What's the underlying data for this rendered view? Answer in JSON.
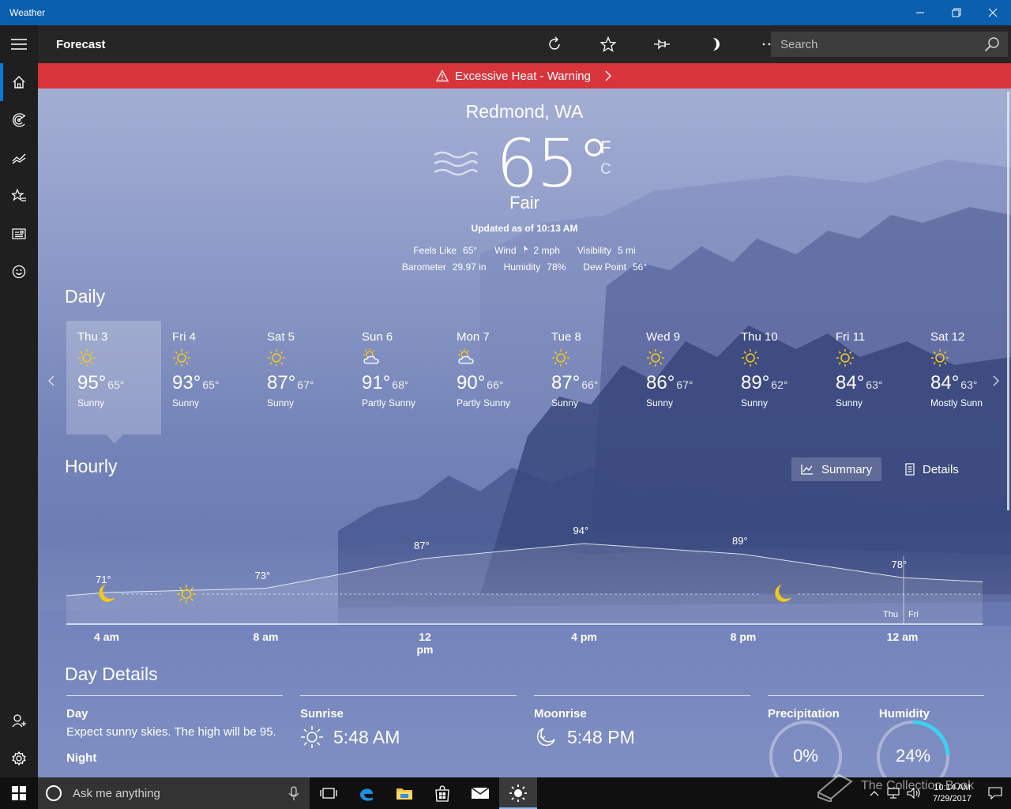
{
  "window": {
    "title": "Weather"
  },
  "command_bar": {
    "page_title": "Forecast",
    "search_placeholder": "Search"
  },
  "alert": {
    "text": "Excessive Heat - Warning"
  },
  "current": {
    "location": "Redmond, WA",
    "temperature": "65°",
    "unit_f": "F",
    "unit_c": "C",
    "condition": "Fair",
    "updated": "Updated as of 10:13 AM",
    "feels_like_label": "Feels Like",
    "feels_like": "65°",
    "wind_label": "Wind",
    "wind": "2 mph",
    "visibility_label": "Visibility",
    "visibility": "5 mi",
    "barometer_label": "Barometer",
    "barometer": "29.97 in",
    "humidity_label": "Humidity",
    "humidity": "78%",
    "dew_point_label": "Dew Point",
    "dew_point": "56°"
  },
  "daily": {
    "heading": "Daily",
    "days": [
      {
        "name": "Thu 3",
        "hi": "95°",
        "lo": "65°",
        "cond": "Sunny",
        "icon": "sun-icon"
      },
      {
        "name": "Fri 4",
        "hi": "93°",
        "lo": "65°",
        "cond": "Sunny",
        "icon": "sun-icon"
      },
      {
        "name": "Sat 5",
        "hi": "87°",
        "lo": "67°",
        "cond": "Sunny",
        "icon": "sun-icon"
      },
      {
        "name": "Sun 6",
        "hi": "91°",
        "lo": "68°",
        "cond": "Partly Sunny",
        "icon": "partly-sunny-icon"
      },
      {
        "name": "Mon 7",
        "hi": "90°",
        "lo": "66°",
        "cond": "Partly Sunny",
        "icon": "partly-sunny-icon"
      },
      {
        "name": "Tue 8",
        "hi": "87°",
        "lo": "66°",
        "cond": "Sunny",
        "icon": "sun-icon"
      },
      {
        "name": "Wed 9",
        "hi": "86°",
        "lo": "67°",
        "cond": "Sunny",
        "icon": "sun-icon"
      },
      {
        "name": "Thu 10",
        "hi": "89°",
        "lo": "62°",
        "cond": "Sunny",
        "icon": "sun-icon"
      },
      {
        "name": "Fri 11",
        "hi": "84°",
        "lo": "63°",
        "cond": "Sunny",
        "icon": "sun-icon"
      },
      {
        "name": "Sat 12",
        "hi": "84°",
        "lo": "63°",
        "cond": "Mostly Sunn",
        "icon": "sun-icon"
      }
    ]
  },
  "hourly": {
    "heading": "Hourly",
    "summary_label": "Summary",
    "details_label": "Details",
    "time_labels": [
      "4 am",
      "8 am",
      "12 pm",
      "4 pm",
      "8 pm",
      "12 am"
    ],
    "points": [
      {
        "label": "71°",
        "value": 71
      },
      {
        "label": "73°",
        "value": 73
      },
      {
        "label": "87°",
        "value": 87
      },
      {
        "label": "94°",
        "value": 94
      },
      {
        "label": "89°",
        "value": 89
      },
      {
        "label": "78°",
        "value": 78
      }
    ],
    "day_divider_left": "Thu",
    "day_divider_right": "Fri"
  },
  "day_details": {
    "heading": "Day Details",
    "day_label": "Day",
    "day_text": "Expect sunny skies. The high will be 95.",
    "night_label": "Night",
    "sunrise_label": "Sunrise",
    "sunrise": "5:48 AM",
    "moonrise_label": "Moonrise",
    "moonrise": "5:48 PM",
    "precip_label": "Precipitation",
    "precip": "0%",
    "precip_value": 0,
    "humidity_label": "Humidity",
    "humidity": "24%",
    "humidity_value": 0.24
  },
  "taskbar": {
    "search_placeholder": "Ask me anything",
    "time": "10:14 AM",
    "date": "7/29/2017",
    "watermark": "The Collection Book"
  },
  "colors": {
    "title_bar": "#0a5fae",
    "alert": "#d8343c",
    "sun": "#f2c81b",
    "humidity_ring": "#3fd0f0"
  }
}
